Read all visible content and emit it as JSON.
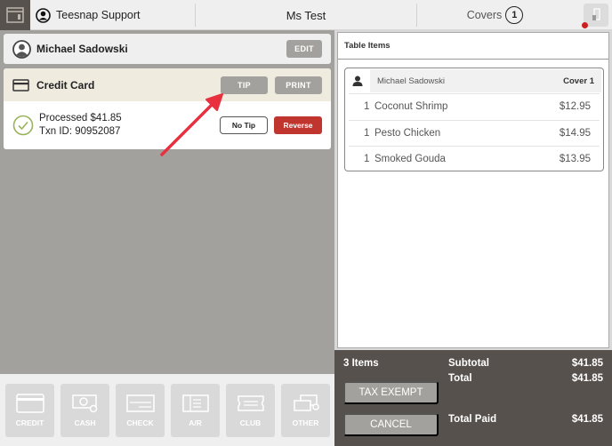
{
  "topbar": {
    "app_icon": "register-icon",
    "user_icon": "user-circle-icon",
    "user_name": "Teesnap Support",
    "table_name": "Ms Test",
    "covers_label": "Covers",
    "covers_count": "1",
    "device_icon": "device-icon",
    "status_dot_color": "#cc1f1f"
  },
  "customer": {
    "name": "Michael Sadowski",
    "edit_label": "EDIT"
  },
  "payment": {
    "method": "Credit Card",
    "tip_label": "TIP",
    "print_label": "PRINT",
    "status_line": "Processed $41.85",
    "txn_line": "Txn ID: 90952087",
    "no_tip_label": "No Tip",
    "reverse_label": "Reverse"
  },
  "tenders": [
    {
      "label": "CREDIT",
      "icon": "credit-card-icon"
    },
    {
      "label": "CASH",
      "icon": "cash-icon"
    },
    {
      "label": "CHECK",
      "icon": "check-icon"
    },
    {
      "label": "A/R",
      "icon": "ledger-icon"
    },
    {
      "label": "CLUB",
      "icon": "ticket-icon"
    },
    {
      "label": "OTHER",
      "icon": "other-cards-icon"
    }
  ],
  "table_items": {
    "header": "Table Items",
    "cover": {
      "guest": "Michael Sadowski",
      "label": "Cover 1",
      "items": [
        {
          "qty": "1",
          "name": "Coconut Shrimp",
          "price": "$12.95"
        },
        {
          "qty": "1",
          "name": "Pesto Chicken",
          "price": "$14.95"
        },
        {
          "qty": "1",
          "name": "Smoked Gouda",
          "price": "$13.95"
        }
      ]
    }
  },
  "summary": {
    "items_count": "3 Items",
    "tax_exempt_label": "TAX EXEMPT",
    "cancel_label": "CANCEL",
    "subtotal_label": "Subtotal",
    "subtotal_value": "$41.85",
    "total_label": "Total",
    "total_value": "$41.85",
    "total_paid_label": "Total Paid",
    "total_paid_value": "$41.85"
  },
  "colors": {
    "accent_red": "#c0362f",
    "annotation_arrow": "#e8303f",
    "success_green": "#9ab25a"
  }
}
